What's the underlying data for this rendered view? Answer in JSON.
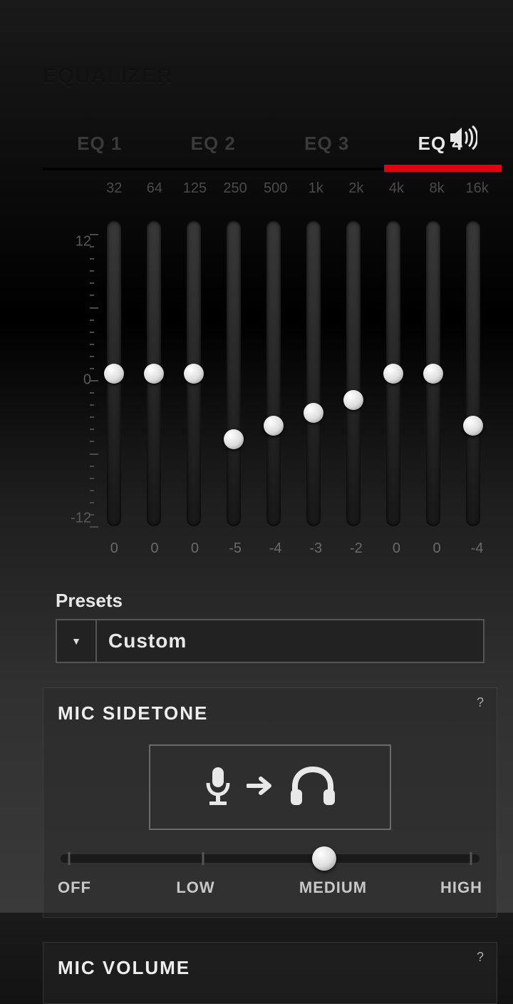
{
  "title": "EQUALIZER",
  "tabs": [
    "EQ 1",
    "EQ 2",
    "EQ 3",
    "EQ 4"
  ],
  "active_tab": 3,
  "eq": {
    "freqs": [
      "32",
      "64",
      "125",
      "250",
      "500",
      "1k",
      "2k",
      "4k",
      "8k",
      "16k"
    ],
    "min": -12,
    "max": 12,
    "axis_labels": {
      "top": "12",
      "mid": "0",
      "bot": "-12"
    },
    "values": [
      0,
      0,
      0,
      -5,
      -4,
      -3,
      -2,
      0,
      0,
      -4
    ]
  },
  "presets": {
    "label": "Presets",
    "selected": "Custom"
  },
  "sidetone": {
    "title": "MIC SIDETONE",
    "levels": [
      "OFF",
      "LOW",
      "MEDIUM",
      "HIGH"
    ],
    "selected_index": 2
  },
  "mic_volume": {
    "title": "MIC VOLUME"
  }
}
